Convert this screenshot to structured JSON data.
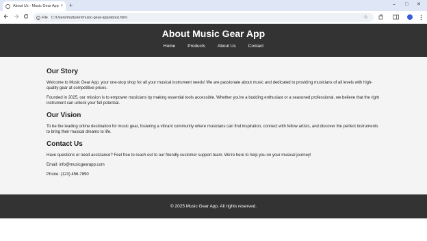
{
  "browser": {
    "tab_title": "About Us - Music Gear App",
    "tab_close": "×",
    "new_tab": "+",
    "file_chip": "File",
    "url": "C:/Users/mutty/eri/music-gear-app/about.html",
    "window_controls": [
      "–",
      "□",
      "✕"
    ]
  },
  "header": {
    "title": "About Music Gear App",
    "nav": [
      "Home",
      "Products",
      "About Us",
      "Contact"
    ]
  },
  "sections": {
    "story_title": "Our Story",
    "story_p1": "Welcome to Music Gear App, your one-stop shop for all your musical instrument needs! We are passionate about music and dedicated to providing musicians of all levels with high-quality gear at competitive prices.",
    "story_p2": "Founded in 2025, our mission is to empower musicians by making essential tools accessible. Whether you're a budding enthusiast or a seasoned professional, we believe that the right instrument can unlock your full potential.",
    "vision_title": "Our Vision",
    "vision_p1": "To be the leading online destination for music gear, fostering a vibrant community where musicians can find inspiration, connect with fellow artists, and discover the perfect instruments to bring their musical dreams to life.",
    "contact_title": "Contact Us",
    "contact_p1": "Have questions or need assistance? Feel free to reach out to our friendly customer support team. We're here to help you on your musical journey!",
    "email": "Email: info@musicgearapp.com",
    "phone": "Phone: (123) 456-7890"
  },
  "footer": {
    "text": "© 2025 Music Gear App. All rights reserved."
  },
  "icons": [
    "globe-icon",
    "back-arrow-icon",
    "forward-arrow-icon",
    "reload-icon",
    "info-icon",
    "star-icon",
    "extensions-icon",
    "sidebar-icon",
    "profile-icon",
    "menu-icon"
  ]
}
